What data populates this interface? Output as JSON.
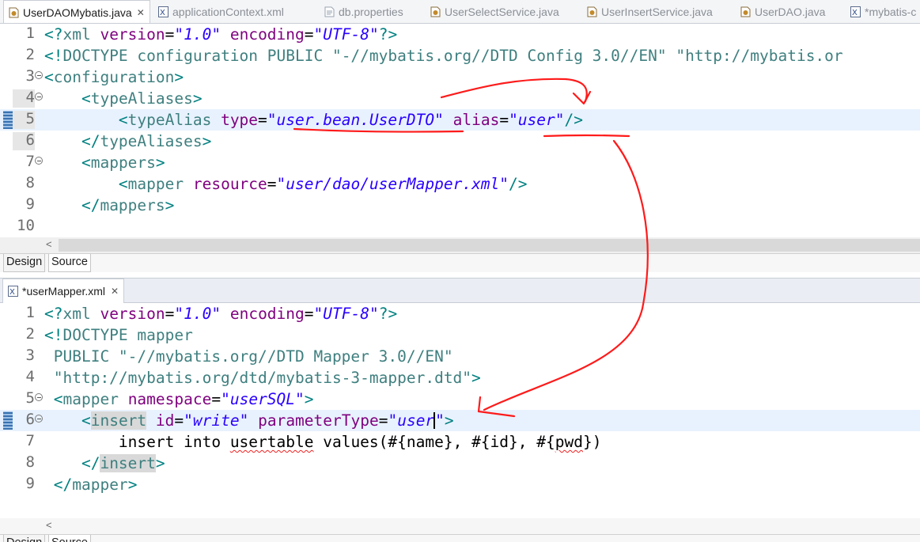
{
  "top_tabs": [
    {
      "label": "UserDAOMybatis.java",
      "icon": "java-file-icon",
      "active": true,
      "close": "✕"
    },
    {
      "label": "applicationContext.xml",
      "icon": "xml-file-icon",
      "active": false
    },
    {
      "label": "db.properties",
      "icon": "properties-file-icon",
      "active": false
    },
    {
      "label": "UserSelectService.java",
      "icon": "java-file-icon",
      "active": false
    },
    {
      "label": "UserInsertService.java",
      "icon": "java-file-icon",
      "active": false
    },
    {
      "label": "UserDAO.java",
      "icon": "java-file-icon",
      "active": false
    },
    {
      "label": "*mybatis-c",
      "icon": "xml-file-icon",
      "active": false
    }
  ],
  "editor1": {
    "lines": [
      {
        "num": "1",
        "tokens": [
          [
            "ang",
            "<?"
          ],
          [
            "tag",
            "xml "
          ],
          [
            "attr",
            "version"
          ],
          [
            "plain",
            "="
          ],
          [
            "val",
            "\"1.0\""
          ],
          [
            "plain",
            " "
          ],
          [
            "attr",
            "encoding"
          ],
          [
            "plain",
            "="
          ],
          [
            "val",
            "\"UTF-8\""
          ],
          [
            "ang",
            "?>"
          ]
        ]
      },
      {
        "num": "2",
        "tokens": [
          [
            "ang",
            "<!"
          ],
          [
            "doct",
            "DOCTYPE configuration PUBLIC "
          ],
          [
            "dq",
            "\"-//mybatis.org//DTD Config 3.0//EN\" \"http://mybatis.or"
          ]
        ]
      },
      {
        "num": "3",
        "fold": true,
        "tokens": [
          [
            "ang",
            "<"
          ],
          [
            "tag",
            "configuration"
          ],
          [
            "ang",
            ">"
          ]
        ]
      },
      {
        "num": "4",
        "fold": true,
        "gray": true,
        "tokens": [
          [
            "plain",
            "    "
          ],
          [
            "ang",
            "<"
          ],
          [
            "tag",
            "typeAliases"
          ],
          [
            "ang",
            ">"
          ]
        ]
      },
      {
        "num": "5",
        "change": true,
        "hl": true,
        "gray": true,
        "tokens": [
          [
            "plain",
            "        "
          ],
          [
            "ang",
            "<"
          ],
          [
            "tag",
            "typeAlias "
          ],
          [
            "attr",
            "type"
          ],
          [
            "plain",
            "="
          ],
          [
            "val",
            "\"user.bean.UserDTO\""
          ],
          [
            "plain",
            " "
          ],
          [
            "attr",
            "alias"
          ],
          [
            "plain",
            "="
          ],
          [
            "val",
            "\"user\""
          ],
          [
            "ang",
            "/>"
          ]
        ]
      },
      {
        "num": "6",
        "gray": true,
        "tokens": [
          [
            "plain",
            "    "
          ],
          [
            "ang",
            "</"
          ],
          [
            "tag",
            "typeAliases"
          ],
          [
            "ang",
            ">"
          ]
        ]
      },
      {
        "num": "7",
        "fold": true,
        "tokens": [
          [
            "plain",
            "    "
          ],
          [
            "ang",
            "<"
          ],
          [
            "tag",
            "mappers"
          ],
          [
            "ang",
            ">"
          ]
        ]
      },
      {
        "num": "8",
        "tokens": [
          [
            "plain",
            "        "
          ],
          [
            "ang",
            "<"
          ],
          [
            "tag",
            "mapper "
          ],
          [
            "attr",
            "resource"
          ],
          [
            "plain",
            "="
          ],
          [
            "val",
            "\"user/dao/userMapper.xml\""
          ],
          [
            "ang",
            "/>"
          ]
        ]
      },
      {
        "num": "9",
        "tokens": [
          [
            "plain",
            "    "
          ],
          [
            "ang",
            "</"
          ],
          [
            "tag",
            "mappers"
          ],
          [
            "ang",
            ">"
          ]
        ]
      },
      {
        "num": "10",
        "tokens": []
      }
    ],
    "scroll_arrow": "<",
    "design_tab": "Design",
    "source_tab": "Source"
  },
  "editor2": {
    "tab_label": "*userMapper.xml",
    "tab_close": "✕",
    "lines": [
      {
        "num": "1",
        "tokens": [
          [
            "ang",
            "<?"
          ],
          [
            "tag",
            "xml "
          ],
          [
            "attr",
            "version"
          ],
          [
            "plain",
            "="
          ],
          [
            "val",
            "\"1.0\""
          ],
          [
            "plain",
            " "
          ],
          [
            "attr",
            "encoding"
          ],
          [
            "plain",
            "="
          ],
          [
            "val",
            "\"UTF-8\""
          ],
          [
            "ang",
            "?>"
          ]
        ]
      },
      {
        "num": "2",
        "tokens": [
          [
            "ang",
            "<!"
          ],
          [
            "doct",
            "DOCTYPE mapper"
          ]
        ]
      },
      {
        "num": "3",
        "tokens": [
          [
            "doct",
            " PUBLIC "
          ],
          [
            "dq",
            "\"-//mybatis.org//DTD Mapper 3.0//EN\""
          ]
        ]
      },
      {
        "num": "4",
        "tokens": [
          [
            "dq",
            " \"http://mybatis.org/dtd/mybatis-3-mapper.dtd\""
          ],
          [
            "ang",
            ">"
          ]
        ]
      },
      {
        "num": "5",
        "fold": true,
        "tokens": [
          [
            "plain",
            " "
          ],
          [
            "ang",
            "<"
          ],
          [
            "tag",
            "mapper "
          ],
          [
            "attr",
            "namespace"
          ],
          [
            "plain",
            "="
          ],
          [
            "val",
            "\"userSQL\""
          ],
          [
            "ang",
            ">"
          ]
        ]
      },
      {
        "num": "6",
        "fold": true,
        "change": true,
        "hl": true,
        "tokens": [
          [
            "plain",
            "    "
          ],
          [
            "ang",
            "<"
          ],
          [
            "tag boxed",
            "insert"
          ],
          [
            "plain",
            " "
          ],
          [
            "attr",
            "id"
          ],
          [
            "plain",
            "="
          ],
          [
            "val",
            "\"write\""
          ],
          [
            "plain",
            " "
          ],
          [
            "attr",
            "parameterType"
          ],
          [
            "plain",
            "="
          ],
          [
            "val",
            "\"user"
          ],
          [
            "caret",
            ""
          ],
          [
            "val",
            "\""
          ],
          [
            "ang",
            ">"
          ]
        ]
      },
      {
        "num": "7",
        "tokens": [
          [
            "plain",
            "        insert into "
          ],
          [
            "plain squig",
            "usertable"
          ],
          [
            "plain",
            " values(#{name}, #{id}, #{"
          ],
          [
            "plain squig",
            "pwd"
          ],
          [
            "plain",
            "})"
          ]
        ]
      },
      {
        "num": "8",
        "tokens": [
          [
            "plain",
            "    "
          ],
          [
            "ang",
            "</"
          ],
          [
            "tag boxed",
            "insert"
          ],
          [
            "ang",
            ">"
          ]
        ]
      },
      {
        "num": "9",
        "tokens": [
          [
            "plain",
            " "
          ],
          [
            "ang",
            "</"
          ],
          [
            "tag",
            "mapper"
          ],
          [
            "ang",
            ">"
          ]
        ]
      }
    ],
    "scroll_arrow": "<",
    "design_tab": "Design",
    "source_tab": "Source"
  },
  "colors": {
    "annotation": "#ff0000",
    "line_highlight": "#e8f2fe",
    "attr_value": "#2a00ff"
  }
}
